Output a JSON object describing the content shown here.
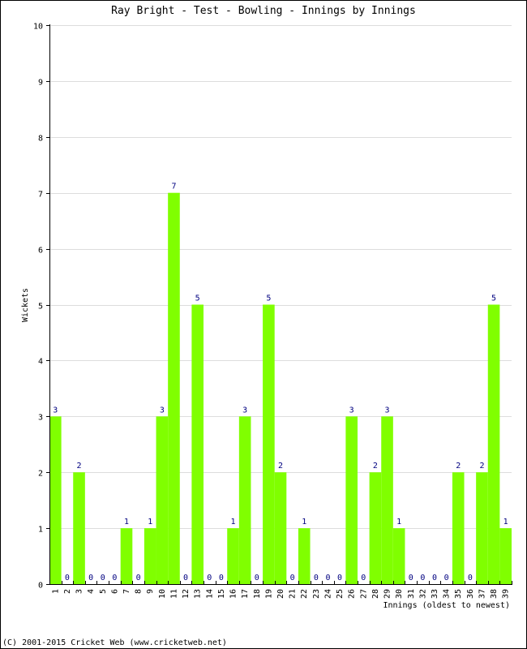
{
  "chart_data": {
    "type": "bar",
    "title": "Ray Bright - Test - Bowling - Innings by Innings",
    "xlabel": "Innings (oldest to newest)",
    "ylabel": "Wickets",
    "ylim": [
      0,
      10
    ],
    "yticks": [
      0,
      1,
      2,
      3,
      4,
      5,
      6,
      7,
      8,
      9,
      10
    ],
    "grid": true,
    "categories": [
      "1",
      "2",
      "3",
      "4",
      "5",
      "6",
      "7",
      "8",
      "9",
      "10",
      "11",
      "12",
      "13",
      "14",
      "15",
      "16",
      "17",
      "18",
      "19",
      "20",
      "21",
      "22",
      "23",
      "24",
      "25",
      "26",
      "27",
      "28",
      "29",
      "30",
      "31",
      "32",
      "33",
      "34",
      "35",
      "36",
      "37",
      "38",
      "39"
    ],
    "values": [
      3,
      0,
      2,
      0,
      0,
      0,
      1,
      0,
      1,
      3,
      7,
      0,
      5,
      0,
      0,
      1,
      3,
      0,
      5,
      2,
      0,
      1,
      0,
      0,
      0,
      3,
      0,
      2,
      3,
      1,
      0,
      0,
      0,
      0,
      2,
      0,
      2,
      5,
      1
    ],
    "bar_color": "#80ff00",
    "label_color": "#000080",
    "grid_color": "#dddddd"
  },
  "footer": "(C) 2001-2015 Cricket Web (www.cricketweb.net)"
}
